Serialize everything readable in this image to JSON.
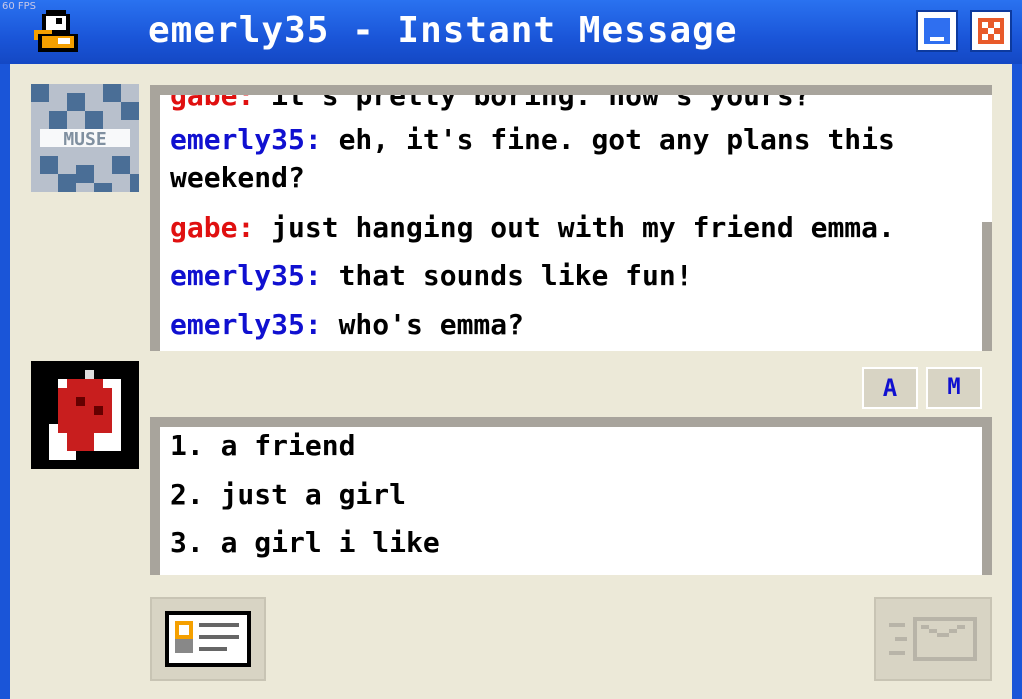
{
  "overlay": {
    "fps": "60 FPS"
  },
  "window": {
    "title": "emerly35 - Instant Message",
    "icons": {
      "app": "duck-icon",
      "minimize": "minimize-icon",
      "close": "close-icon"
    }
  },
  "avatars": {
    "top": "muse-avatar",
    "bottom": "heart-in-hand-avatar",
    "top_text": "MUSE"
  },
  "chat": {
    "messages": [
      {
        "name": "gabe",
        "sep": ":",
        "text": " it's pretty boring. how's yours?"
      },
      {
        "name": "emerly35",
        "sep": ":",
        "text": " eh, it's fine. got any plans this",
        "cont": "weekend?"
      },
      {
        "name": "gabe",
        "sep": ":",
        "text": " just hanging out with my friend emma."
      },
      {
        "name": "emerly35",
        "sep": ":",
        "text": " that sounds like fun!"
      },
      {
        "name": "emerly35",
        "sep": ":",
        "text": " who's emma?"
      }
    ]
  },
  "format_buttons": {
    "font": "A",
    "style": "M"
  },
  "reply": {
    "options": [
      "1. a friend",
      "2. just a girl",
      "3. a girl i like"
    ]
  },
  "footer": {
    "profile_icon": "profile-card-icon",
    "send_icon": "send-mail-icon"
  },
  "colors": {
    "titlebar": "#1a55d8",
    "name_self": "#1010d0",
    "name_other": "#e01010",
    "panel": "#ece9d8"
  }
}
